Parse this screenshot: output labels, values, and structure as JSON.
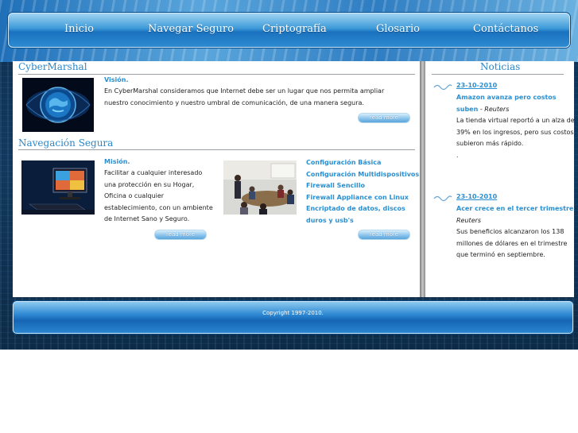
{
  "nav": {
    "items": [
      "Inicio",
      "Navegar Seguro",
      "Criptografía",
      "Glosario",
      "Contáctanos"
    ]
  },
  "cybermarshal": {
    "title": "CyberMarshal",
    "lead": "Visión.",
    "text": "En CyberMarshal consideramos que Internet debe ser un lugar que nos permita ampliar nuestro conocimiento y nuestro umbral de comunicación, de una manera segura.",
    "read_more": "read more"
  },
  "navegacion": {
    "title": "Navegación Segura",
    "lead": "Misión.",
    "text": "Facilitar a cualquier interesado una protección en su Hogar, Oficina o cualquier establecimiento, con un ambiente de Internet Sano y Seguro.",
    "read_more": "read more",
    "links": [
      "Configuración Básica",
      "Configuración Multidispositivos",
      "Firewall Sencillo",
      "Firewall Appliance con Linux",
      "Encriptado de datos, discos",
      "duros y usb's"
    ],
    "read_more_2": "read more"
  },
  "noticias": {
    "title": "Noticias",
    "items": [
      {
        "date": "23-10-2010",
        "headline": "Amazon avanza pero costos suben",
        "source": "Reuters",
        "text": "La tienda virtual reportó a un alza de 39% en los ingresos, pero sus costos subieron más rápido.",
        "extra": "."
      },
      {
        "date": "23-10-2010",
        "headline": "Acer crece en el tercer trimestre",
        "source": "Reuters",
        "text": "Sus beneficios alcanzaron los 138 millones de dólares en el trimestre que terminó en septiembre."
      }
    ]
  },
  "footer": {
    "copyright": "Copyright 1997-2010."
  },
  "colors": {
    "accent": "#2a8fd0",
    "nav_blue": "#1a72c0",
    "background": "#12395d"
  }
}
